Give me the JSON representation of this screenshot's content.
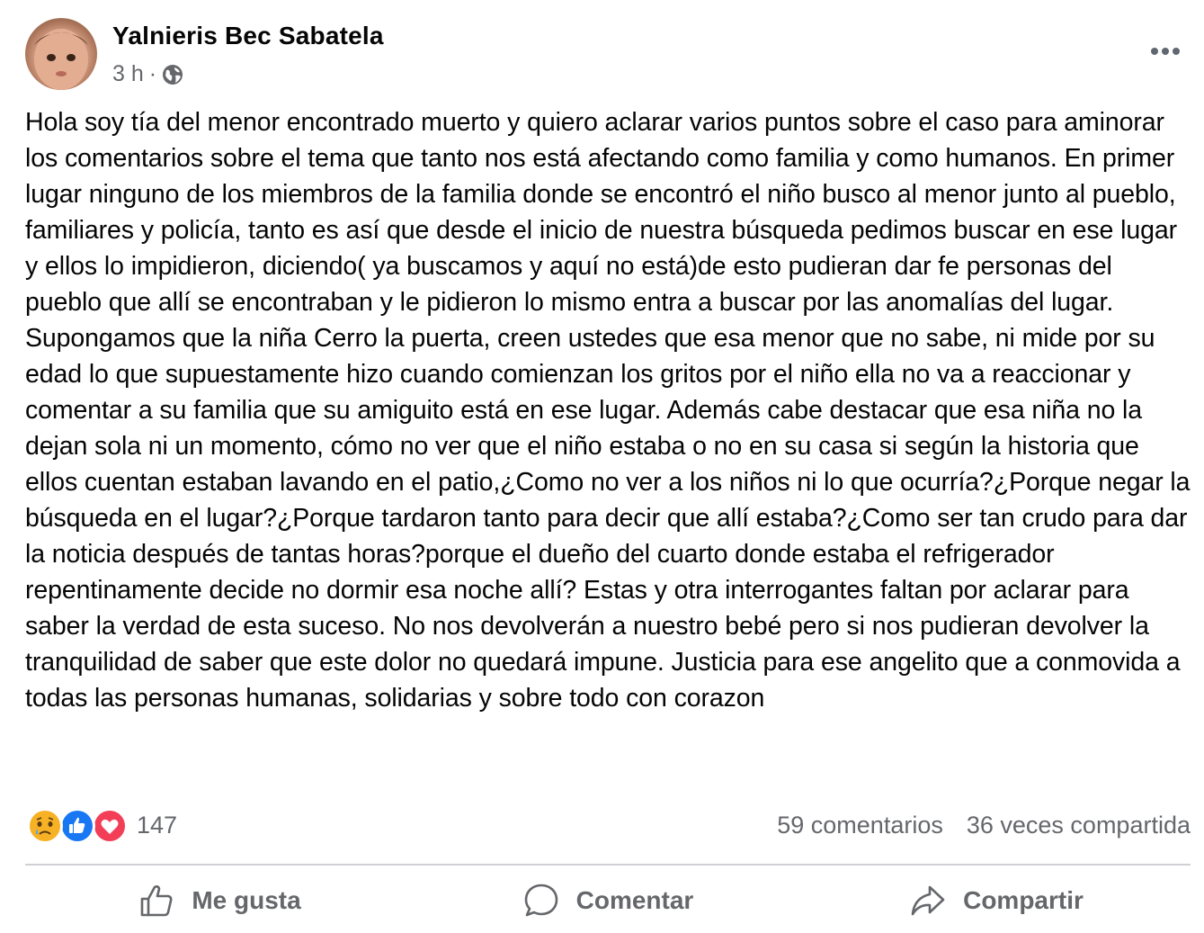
{
  "post": {
    "author": "Yalnieris Bec Sabatela",
    "time": "3 h",
    "separator": "·",
    "audience_icon": "globe-icon",
    "body": "Hola soy tía del menor encontrado muerto y quiero aclarar varios puntos sobre el caso para aminorar los comentarios sobre el tema que tanto nos está afectando como familia y como humanos. En primer lugar ninguno de los miembros de la familia donde se encontró el niño busco al menor junto al pueblo, familiares y policía, tanto es así que desde el inicio de nuestra búsqueda pedimos buscar en ese lugar y ellos lo impidieron, diciendo( ya buscamos y aquí no está)de esto pudieran dar fe personas del pueblo que allí se encontraban y le pidieron lo mismo entra a buscar por las anomalías del lugar. Supongamos que la niña Cerro la puerta, creen ustedes que esa menor que no sabe, ni mide por su edad lo que supuestamente hizo cuando comienzan los gritos por el niño ella no va a reaccionar y comentar a su familia que su amiguito está en ese lugar. Además cabe destacar que esa niña no la dejan sola ni un momento, cómo no ver que el niño estaba o no en su casa si según la historia que ellos cuentan estaban lavando en el patio,¿Como no ver a los niños ni lo que ocurría?¿Porque negar la búsqueda en el lugar?¿Porque tardaron tanto para decir que allí estaba?¿Como ser tan crudo para dar la noticia después de tantas horas?porque el dueño del cuarto donde estaba el refrigerador repentinamente decide no dormir esa noche allí? Estas y otra interrogantes faltan por aclarar para saber la verdad de esta suceso. No nos devolverán a nuestro bebé pero si nos pudieran devolver la tranquilidad de saber que este dolor no quedará impune. Justicia para ese angelito que a conmovida a todas las personas humanas, solidarias y sobre todo con corazon"
  },
  "stats": {
    "reaction_icons": [
      "sad-reaction",
      "like-reaction",
      "love-reaction"
    ],
    "reaction_count": "147",
    "comments": "59 comentarios",
    "shares": "36 veces compartida"
  },
  "actions": {
    "like": "Me gusta",
    "comment": "Comentar",
    "share": "Compartir"
  },
  "colors": {
    "text": "#050505",
    "secondary": "#65676b",
    "like_blue": "#1877f2",
    "love_red": "#f33e58",
    "sad_yellow": "#f7b125",
    "divider": "#ced0d4"
  }
}
